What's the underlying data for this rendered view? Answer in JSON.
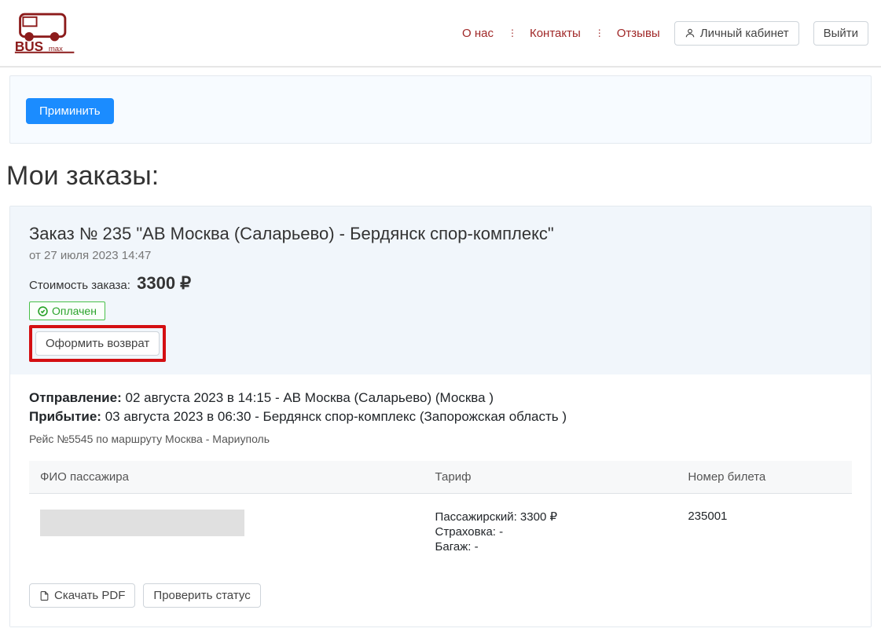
{
  "header": {
    "nav": {
      "about": "О нас",
      "contacts": "Контакты",
      "reviews": "Отзывы"
    },
    "account_button": "Личный кабинет",
    "logout_button": "Выйти"
  },
  "apply_button": "Приминить",
  "page_title": "Мои заказы:",
  "order": {
    "title": "Заказ № 235 \"АВ Москва (Саларьево) - Бердянск спор-комплекс\"",
    "date": "от 27 июля 2023 14:47",
    "cost_label": "Стоимость заказа:",
    "cost_amount": "3300 ₽",
    "status_badge": "Оплачен",
    "refund_button": "Оформить возврат",
    "departure_label": "Отправление:",
    "departure_value": "02 августа 2023 в 14:15 - АВ Москва (Саларьево) (Москва )",
    "arrival_label": "Прибытие:",
    "arrival_value": "03 августа 2023 в 06:30 - Бердянск спор-комплекс (Запорожская область )",
    "trip_sub": "Рейс №5545 по маршруту Москва - Мариуполь",
    "table": {
      "col_fio": "ФИО пассажира",
      "col_tariff": "Тариф",
      "col_ticket": "Номер билета",
      "rows": [
        {
          "tariff_passenger": "Пассажирский: 3300 ₽",
          "tariff_insurance": "Страховка: -",
          "tariff_baggage": "Багаж: -",
          "ticket_no": "235001"
        }
      ]
    },
    "download_pdf": "Скачать PDF",
    "check_status": "Проверить статус"
  }
}
